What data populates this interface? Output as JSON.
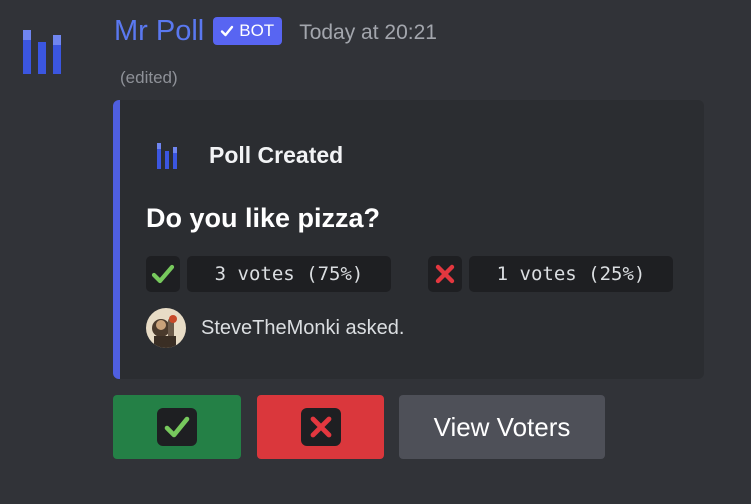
{
  "message": {
    "author": "Mr Poll",
    "bot_tag": "BOT",
    "timestamp": "Today at 20:21",
    "edited": "(edited)"
  },
  "embed": {
    "author_name": "Poll Created",
    "title": "Do you like pizza?",
    "options": [
      {
        "emoji": "green-check-icon",
        "votes_text": "3 votes (75%)"
      },
      {
        "emoji": "red-x-icon",
        "votes_text": "1 votes (25%)"
      }
    ],
    "footer": "SteveTheMonki asked.",
    "accent_color": "#4f5fe0"
  },
  "buttons": {
    "yes_icon": "check-icon",
    "no_icon": "x-icon",
    "view_voters_label": "View Voters"
  },
  "colors": {
    "background": "#313338",
    "embed_background": "#2b2d31",
    "username": "#5a78f0",
    "bot_tag": "#5865f2",
    "success": "#248046",
    "danger": "#da373c",
    "secondary": "#4e5058"
  }
}
